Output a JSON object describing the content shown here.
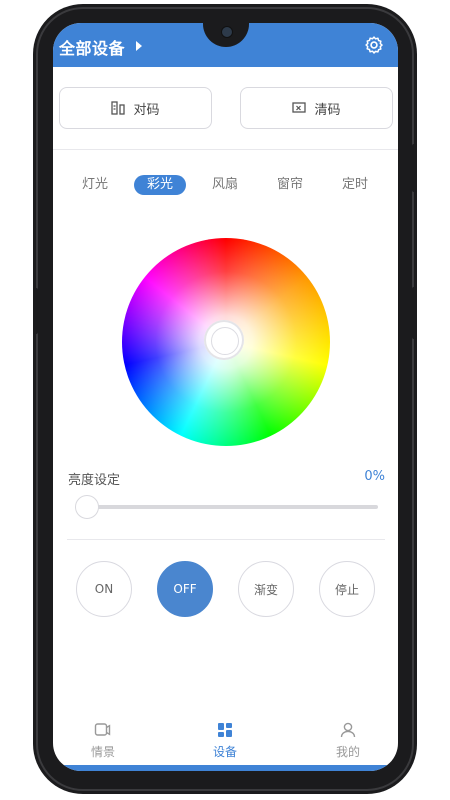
{
  "header": {
    "title": "全部设备",
    "icons": [
      "chevron-right-icon",
      "gear-icon"
    ]
  },
  "pairing": {
    "pair_label": "对码",
    "clear_label": "清码"
  },
  "tabs": [
    {
      "label": "灯光",
      "active": false
    },
    {
      "label": "彩光",
      "active": true
    },
    {
      "label": "风扇",
      "active": false
    },
    {
      "label": "窗帘",
      "active": false
    },
    {
      "label": "定时",
      "active": false
    }
  ],
  "brightness": {
    "label": "亮度设定",
    "value_text": "0%",
    "value": 0
  },
  "modes": [
    {
      "label": "ON",
      "active": false
    },
    {
      "label": "OFF",
      "active": true
    },
    {
      "label": "渐变",
      "active": false
    },
    {
      "label": "停止",
      "active": false
    }
  ],
  "bottom_nav": [
    {
      "label": "情景",
      "icon": "scene-icon",
      "active": false
    },
    {
      "label": "设备",
      "icon": "devices-icon",
      "active": true
    },
    {
      "label": "我的",
      "icon": "profile-icon",
      "active": false
    }
  ],
  "colors": {
    "accent": "#3f83d6",
    "border": "#d9d9df",
    "text": "#555555"
  }
}
